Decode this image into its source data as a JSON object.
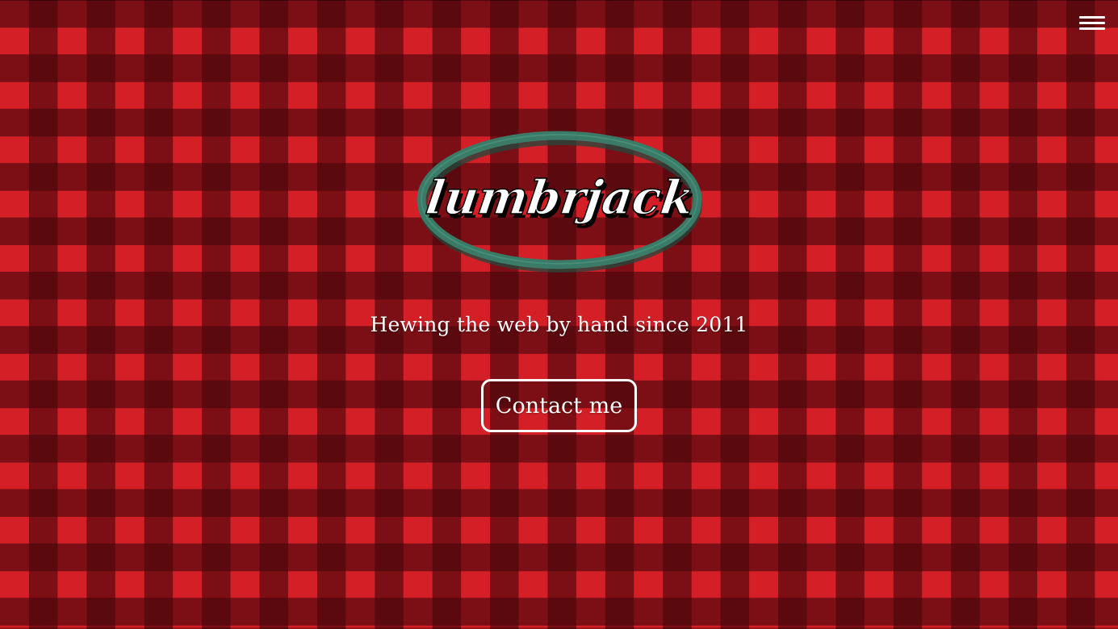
{
  "header": {
    "menu_icon": "hamburger-menu-icon"
  },
  "hero": {
    "logo_text": "lumbrjack",
    "tagline": "Hewing the web by hand since 2011",
    "cta_label": "Contact me"
  },
  "colors": {
    "plaid_red": "#d41f27",
    "plaid_dark": "#3a0509",
    "logo_ring": "#3a7a66",
    "text": "#ffffff"
  }
}
